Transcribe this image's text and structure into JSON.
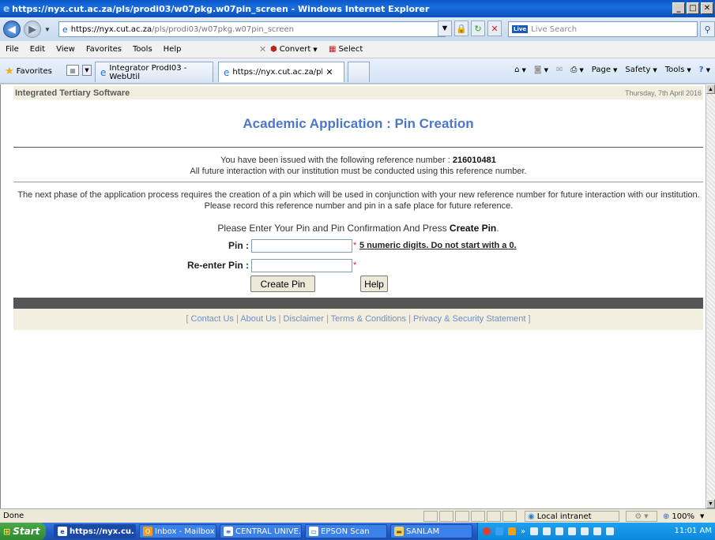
{
  "window": {
    "title": "https://nyx.cut.ac.za/pls/prodi03/w07pkg.w07pin_screen - Windows Internet Explorer",
    "controls": [
      "_",
      "□",
      "✕"
    ]
  },
  "address": {
    "url_host": "https://nyx.cut.ac.za",
    "url_path": "/pls/prodi03/w07pkg.w07pin_screen",
    "search_placeholder": "Live Search",
    "live_badge": "Live"
  },
  "menu": {
    "items": [
      "File",
      "Edit",
      "View",
      "Favorites",
      "Tools",
      "Help"
    ],
    "close_glyph": "✕",
    "convert_label": "Convert",
    "select_label": "Select"
  },
  "favorites": {
    "label": "Favorites",
    "tabs": [
      {
        "label": "Integrator ProdI03 - WebUtil"
      },
      {
        "label": "https://nyx.cut.ac.za/pls...",
        "close": "✕"
      }
    ],
    "commands": {
      "page": "Page",
      "safety": "Safety",
      "tools": "Tools"
    }
  },
  "page": {
    "brand": "Integrated Tertiary Software",
    "date": "Thursday, 7th April 2016",
    "heading": "Academic Application : Pin Creation",
    "ref_prefix": "You have been issued with the following reference number : ",
    "ref_number": "216010481",
    "ref_note": "All future interaction with our institution must be conducted using this reference number.",
    "phase_text": "The next phase of the application process requires the creation of a pin which will be used in conjunction with your new reference number for future interaction with our institution. Please record this reference number and pin in a safe place for future reference.",
    "instruction_prefix": "Please Enter Your Pin and Pin Confirmation And Press ",
    "instruction_bold": "Create Pin",
    "instruction_suffix": ".",
    "pin_label": "Pin :",
    "pin_value": "",
    "pin_hint": "5 numeric digits. Do not start with a 0.",
    "reenter_label": "Re-enter Pin :",
    "reenter_value": "",
    "required_mark": "*",
    "create_button": "Create Pin",
    "help_button": "Help",
    "footer": {
      "open": "[",
      "close": "]",
      "sep": "|",
      "links": [
        "Contact Us",
        "About Us",
        "Disclaimer",
        "Terms & Conditions",
        "Privacy & Security Statement"
      ]
    }
  },
  "status": {
    "text": "Done",
    "zone": "Local intranet",
    "zoom": "100%"
  },
  "taskbar": {
    "start": "Start",
    "tasks": [
      {
        "label": "https://nyx.cu...",
        "icon": "ie-icon"
      },
      {
        "label": "Inbox - Mailbox ...",
        "icon": "outlook-icon"
      },
      {
        "label": "CENTRAL UNIVE...",
        "icon": "document-icon"
      },
      {
        "label": "EPSON Scan",
        "icon": "scanner-icon"
      },
      {
        "label": "SANLAM",
        "icon": "folder-icon"
      }
    ],
    "clock": "11:01 AM"
  }
}
